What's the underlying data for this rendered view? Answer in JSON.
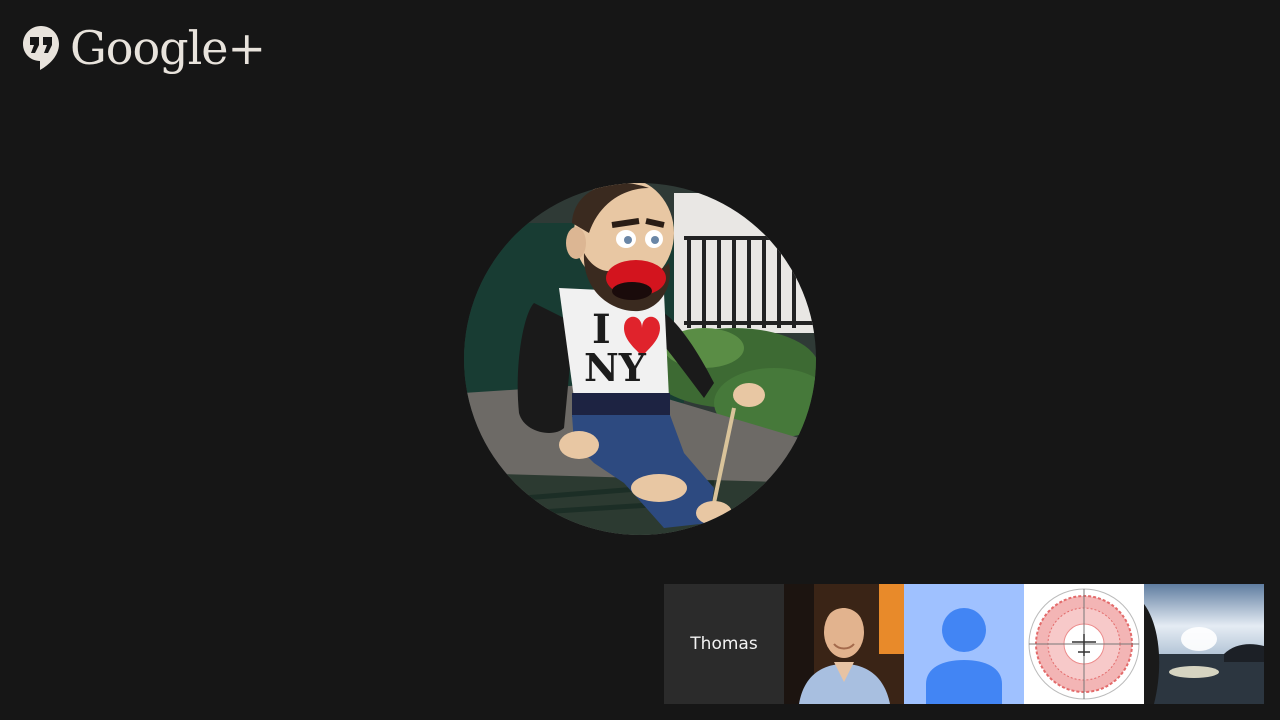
{
  "branding": {
    "name": "Google+",
    "icon": "hangouts-quote-icon",
    "color": "#e8e3dc"
  },
  "main_video": {
    "kind": "active-speaker-avatar",
    "subject": "puppet-photo",
    "shirt_line1": "I",
    "shirt_line2": "NY"
  },
  "participants": [
    {
      "kind": "name-tile",
      "name": "Thomas"
    },
    {
      "kind": "photo",
      "icon": "person-photo"
    },
    {
      "kind": "placeholder",
      "icon": "default-avatar-icon",
      "color": "#4285f4"
    },
    {
      "kind": "image",
      "icon": "radar-plot-image"
    },
    {
      "kind": "image",
      "icon": "lake-sunset-image"
    }
  ],
  "colors": {
    "background": "#161616",
    "name_tile": "#2b2b2b",
    "placeholder_bg": "#9fc1ff"
  }
}
